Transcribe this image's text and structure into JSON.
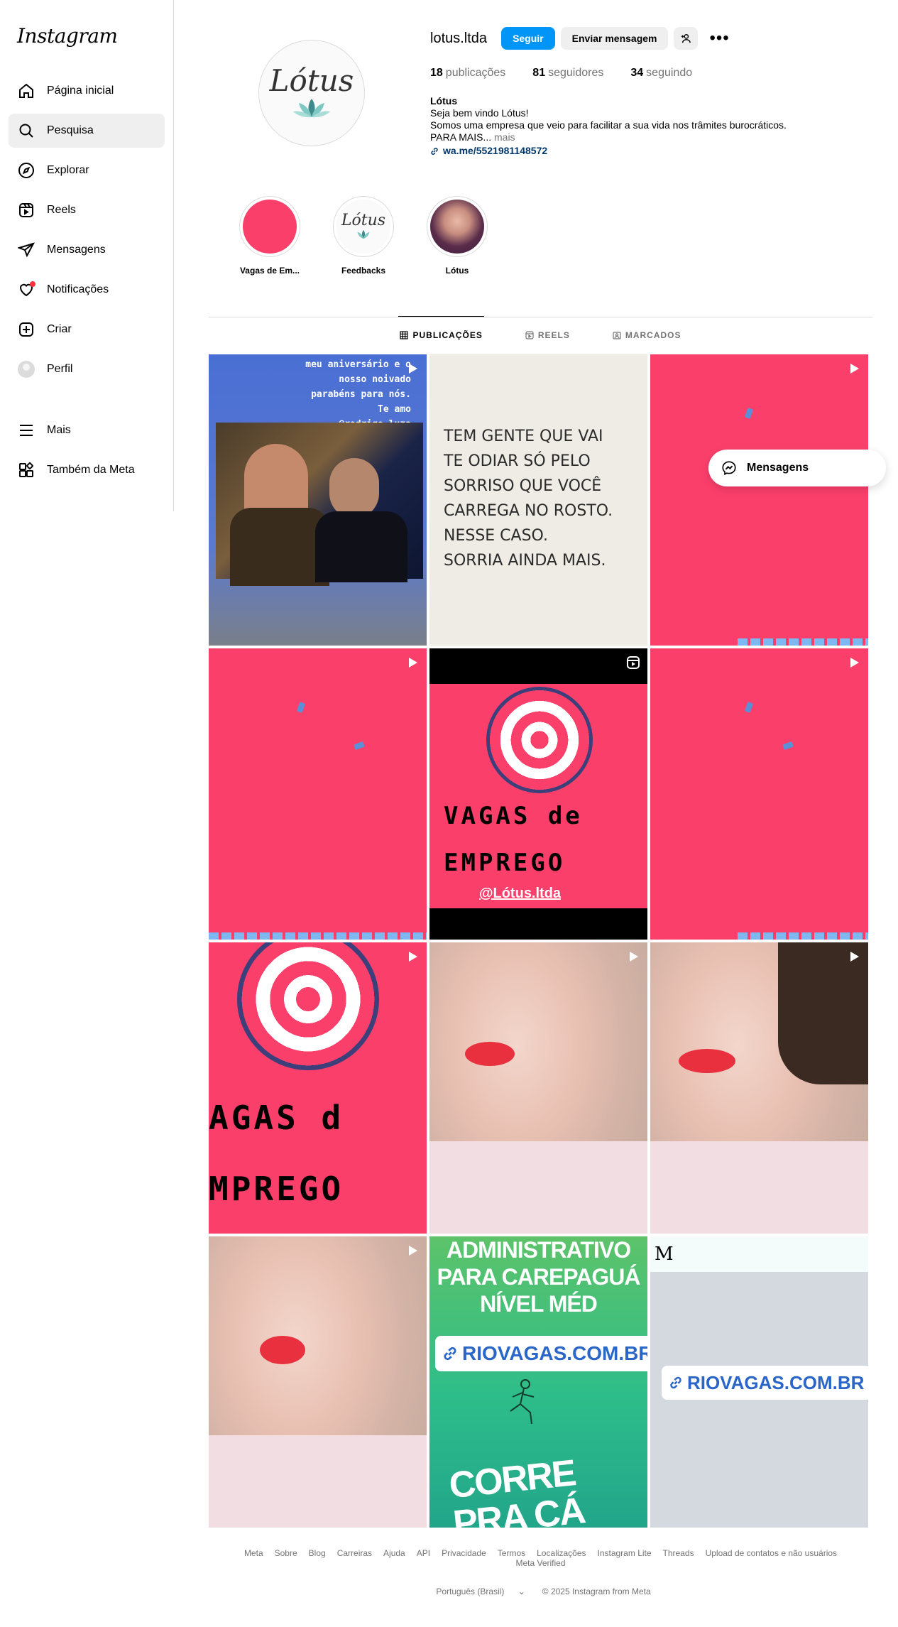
{
  "app": {
    "logo": "Instagram"
  },
  "sidebar": {
    "items": [
      {
        "label": "Página inicial",
        "icon": "home-icon"
      },
      {
        "label": "Pesquisa",
        "icon": "search-icon",
        "active": true
      },
      {
        "label": "Explorar",
        "icon": "compass-icon"
      },
      {
        "label": "Reels",
        "icon": "reels-icon"
      },
      {
        "label": "Mensagens",
        "icon": "send-icon"
      },
      {
        "label": "Notificações",
        "icon": "heart-icon",
        "badge": true
      },
      {
        "label": "Criar",
        "icon": "plus-square-icon"
      },
      {
        "label": "Perfil",
        "icon": "avatar"
      }
    ],
    "more": {
      "label": "Mais",
      "icon": "menu-icon"
    },
    "meta": {
      "label": "Também da Meta",
      "icon": "meta-apps-icon"
    }
  },
  "profile": {
    "username": "lotus.ltda",
    "logo_text": "Lótus",
    "follow_label": "Seguir",
    "message_label": "Enviar mensagem",
    "stats": {
      "posts_count": "18",
      "posts_label": "publicações",
      "followers_count": "81",
      "followers_label": "seguidores",
      "following_count": "34",
      "following_label": "seguindo"
    },
    "bio": {
      "name": "Lótus",
      "line1": "Seja bem vindo Lótus!",
      "line2": "Somos uma empresa que veio para facilitar a sua vida nos trâmites burocráticos.",
      "line3": "PARA MAIS...",
      "more": "mais",
      "link": "wa.me/5521981148572"
    }
  },
  "highlights": [
    {
      "label": "Vagas de Em..."
    },
    {
      "label": "Feedbacks"
    },
    {
      "label": "Lótus"
    }
  ],
  "tabs": [
    {
      "label": "PUBLICAÇÕES",
      "active": true
    },
    {
      "label": "REELS"
    },
    {
      "label": "MARCADOS"
    }
  ],
  "posts": {
    "bday_text": [
      "meu aniversário e o",
      "nosso noivado",
      "parabéns para nós.",
      "Te amo",
      "@rodrigo_luza"
    ],
    "quote_lines": [
      "TEM GENTE QUE VAI",
      "TE ODIAR SÓ PELO",
      "SORRISO QUE VOCÊ",
      "CARREGA NO ROSTO.",
      "NESSE CASO.",
      "SORRIA AINDA MAIS."
    ],
    "vagas_line1": "VAGAS de",
    "vagas_line2": "EMPREGO",
    "vagas_handle": "@Lótus.ltda",
    "vagas_crop_line1": "AGAS d",
    "vagas_crop_line2": "MPREGO",
    "green_top": "ADMINISTRATIVO PARA CAREPAGUÁ NÍVEL MÉD",
    "riovagas": "RIOVAGAS.COM.BR",
    "corre": "CORRE PRA CÁ",
    "m_letter": "M"
  },
  "float_messages": {
    "label": "Mensagens"
  },
  "footer": {
    "links": [
      "Meta",
      "Sobre",
      "Blog",
      "Carreiras",
      "Ajuda",
      "API",
      "Privacidade",
      "Termos",
      "Localizações",
      "Instagram Lite",
      "Threads",
      "Upload de contatos e não usuários",
      "Meta Verified"
    ],
    "language": "Português (Brasil)",
    "copyright": "© 2025 Instagram from Meta"
  },
  "colors": {
    "accent": "#0095f6",
    "pink": "#fb3f6b",
    "badge": "#ff3040"
  }
}
